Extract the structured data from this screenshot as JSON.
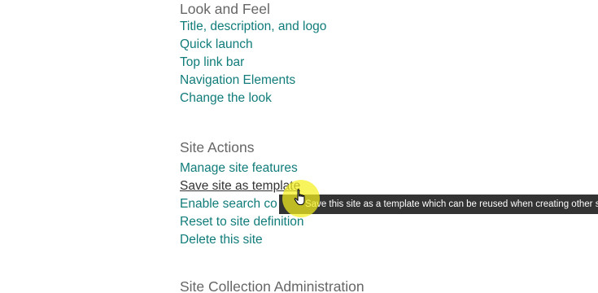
{
  "look_and_feel": {
    "heading": "Look and Feel",
    "links": [
      "Title, description, and logo",
      "Quick launch",
      "Top link bar",
      "Navigation Elements",
      "Change the look"
    ]
  },
  "site_actions": {
    "heading": "Site Actions",
    "links": [
      "Manage site features",
      "Save site as template",
      "Enable search co",
      "Reset to site definition",
      "Delete this site"
    ]
  },
  "site_collection_admin": {
    "heading": "Site Collection Administration"
  },
  "tooltip": {
    "text": "Save this site as a template which can be reused when creating other sites."
  },
  "icons": {
    "cursor": "hand-pointer-icon"
  },
  "colors": {
    "link": "#107c7a",
    "heading": "#666666",
    "tooltip_bg": "#333333",
    "highlight": "#f5f01e"
  }
}
